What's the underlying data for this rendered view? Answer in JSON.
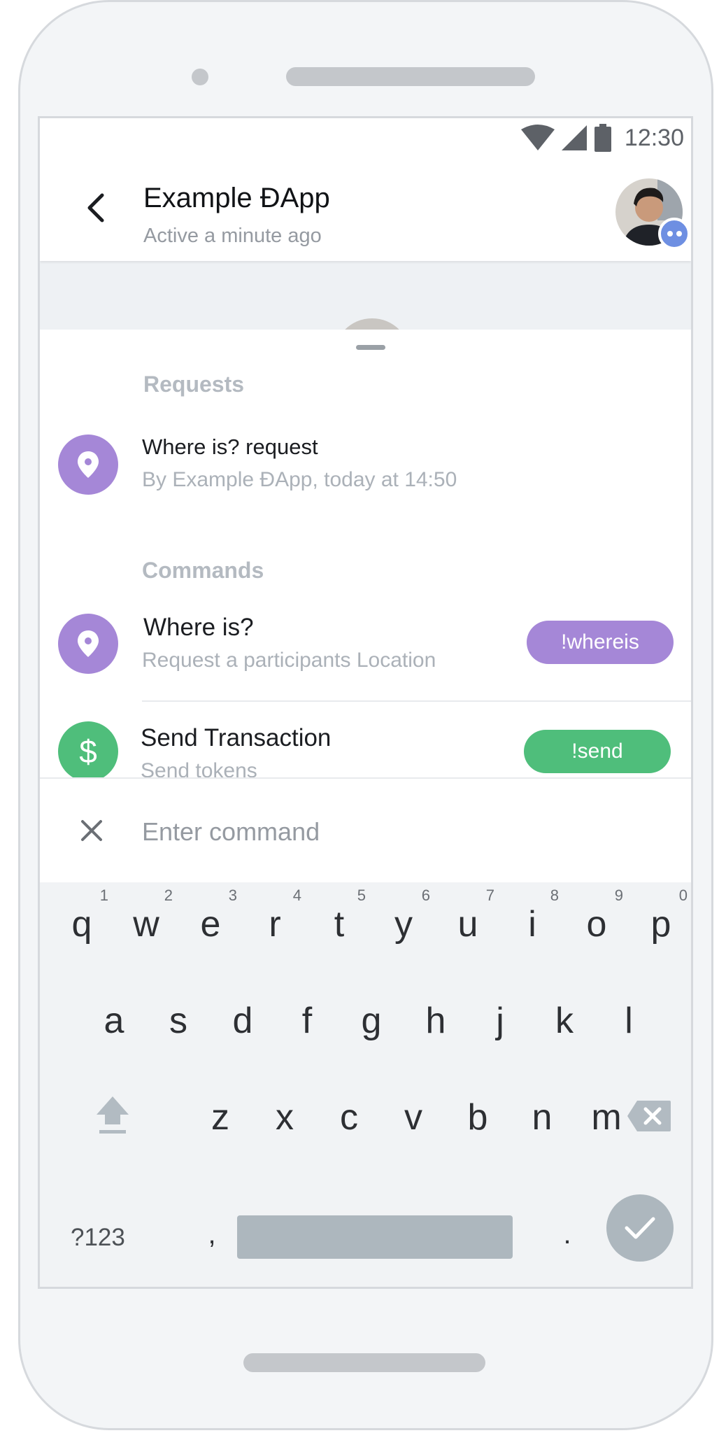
{
  "status_bar": {
    "time": "12:30",
    "icons": [
      "wifi-icon",
      "signal-icon",
      "battery-icon"
    ]
  },
  "header": {
    "back_icon": "chevron-left-icon",
    "title": "Example ĐApp",
    "subtitle": "Active a minute ago"
  },
  "requests": {
    "heading": "Requests",
    "items": [
      {
        "title": "Where is? request",
        "subtitle": "By Example ĐApp, today at 14:50",
        "icon": "location-pin-icon"
      }
    ]
  },
  "commands": {
    "heading": "Commands",
    "items": [
      {
        "title": "Where is?",
        "subtitle": "Request a participants Location",
        "command": "!whereis",
        "icon": "location-pin-icon",
        "color": "#a587d7"
      },
      {
        "title": "Send Transaction",
        "subtitle": "Send tokens",
        "command": "!send",
        "icon": "dollar-icon",
        "color": "#4fbe7b"
      }
    ]
  },
  "input": {
    "placeholder": "Enter command",
    "value": ""
  },
  "keyboard": {
    "row1": [
      {
        "ch": "q",
        "num": "1"
      },
      {
        "ch": "w",
        "num": "2"
      },
      {
        "ch": "e",
        "num": "3"
      },
      {
        "ch": "r",
        "num": "4"
      },
      {
        "ch": "t",
        "num": "5"
      },
      {
        "ch": "y",
        "num": "6"
      },
      {
        "ch": "u",
        "num": "7"
      },
      {
        "ch": "i",
        "num": "8"
      },
      {
        "ch": "o",
        "num": "9"
      },
      {
        "ch": "p",
        "num": "0"
      }
    ],
    "row2": [
      "a",
      "s",
      "d",
      "f",
      "g",
      "h",
      "j",
      "k",
      "l"
    ],
    "row3": [
      "z",
      "x",
      "c",
      "v",
      "b",
      "n",
      "m"
    ],
    "symbols_label": "?123",
    "comma": ",",
    "period": "."
  }
}
